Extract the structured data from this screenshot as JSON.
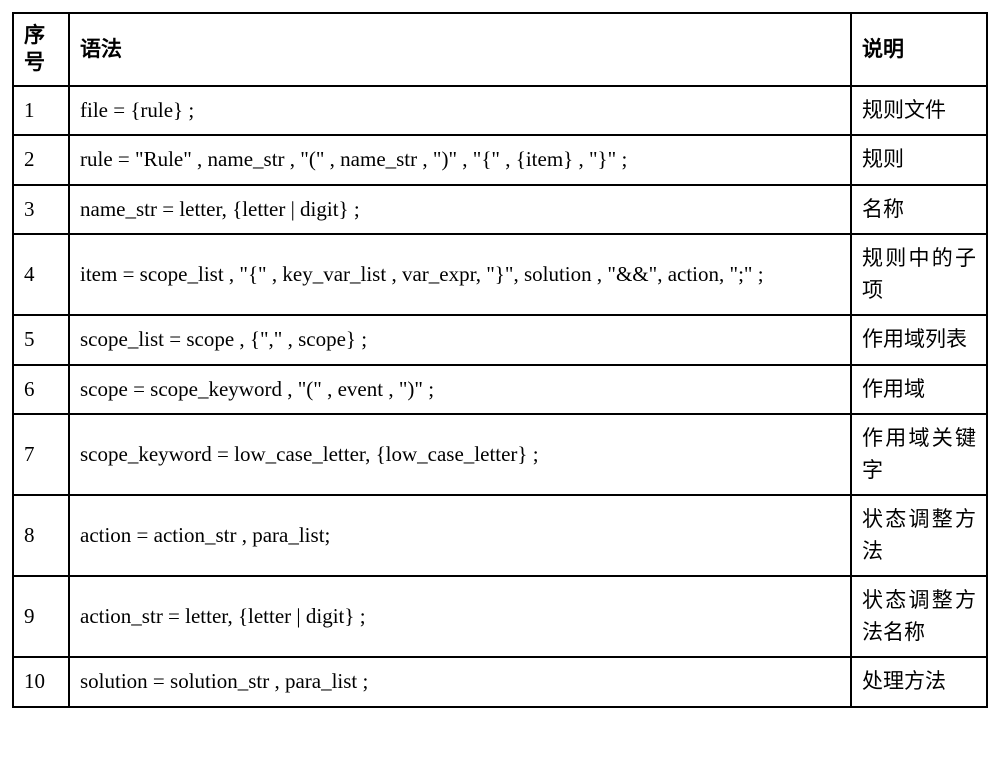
{
  "headers": {
    "seq": "序号",
    "grammar": "语法",
    "desc": "说明"
  },
  "rows": [
    {
      "seq": "1",
      "grammar": "file = {rule} ;",
      "desc": "规则文件"
    },
    {
      "seq": "2",
      "grammar": "rule = \"Rule\" , name_str , \"(\" , name_str , \")\" , \"{\" , {item} , \"}\" ;",
      "desc": "规则"
    },
    {
      "seq": "3",
      "grammar": "name_str = letter, {letter | digit} ;",
      "desc": "名称"
    },
    {
      "seq": "4",
      "grammar": "item = scope_list , \"{\" , key_var_list  , var_expr, \"}\", solution , \"&&\", action, \";\" ;",
      "desc": "规则中的子项"
    },
    {
      "seq": "5",
      "grammar": "scope_list = scope , {\",\" , scope} ;",
      "desc": "作用域列表"
    },
    {
      "seq": "6",
      "grammar": "scope = scope_keyword , \"(\" , event , \")\" ;",
      "desc": "作用域"
    },
    {
      "seq": "7",
      "grammar": "scope_keyword = low_case_letter, {low_case_letter} ;",
      "desc": "作用域关键字"
    },
    {
      "seq": "8",
      "grammar": "action = action_str , para_list;",
      "desc": "状态调整方法"
    },
    {
      "seq": "9",
      "grammar": "action_str = letter, {letter | digit} ;",
      "desc": "状态调整方法名称"
    },
    {
      "seq": "10",
      "grammar": "solution = solution_str , para_list ;",
      "desc": "处理方法"
    }
  ]
}
